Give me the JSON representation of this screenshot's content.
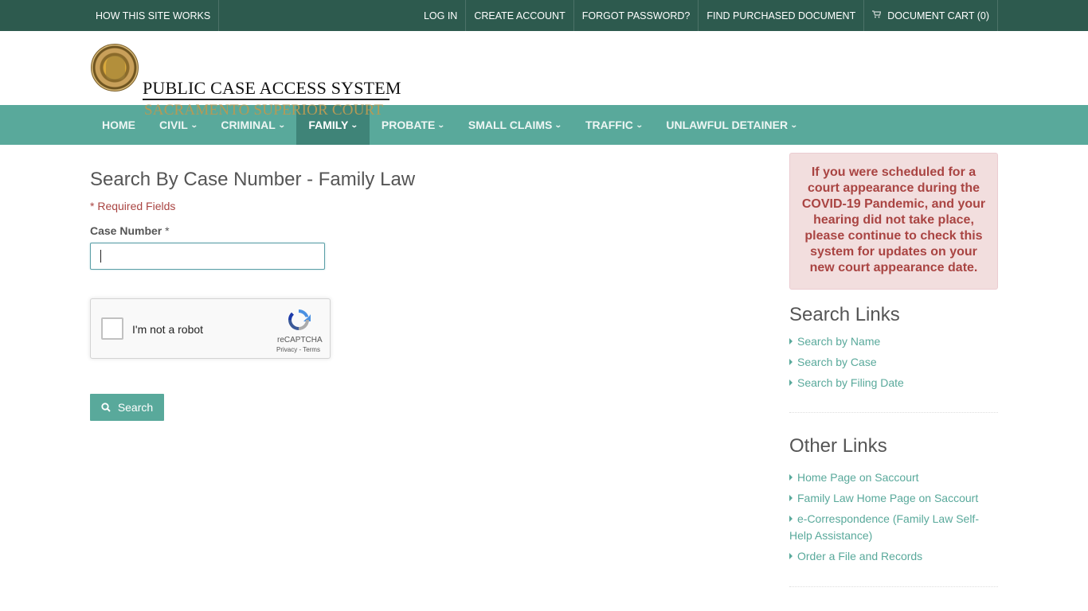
{
  "topbar": {
    "how_it_works": "HOW THIS SITE WORKS",
    "login": "LOG IN",
    "create_account": "CREATE ACCOUNT",
    "forgot_password": "FORGOT PASSWORD?",
    "find_purchased": "FIND PURCHASED DOCUMENT",
    "cart": "DOCUMENT CART (0)",
    "cart_icon": "shopping-cart-icon"
  },
  "header": {
    "title": "PUBLIC CASE ACCESS SYSTEM",
    "subtitle": "SACRAMENTO SUPERIOR COURT"
  },
  "nav": {
    "items": [
      {
        "label": "HOME",
        "dropdown": false
      },
      {
        "label": "CIVIL",
        "dropdown": true
      },
      {
        "label": "CRIMINAL",
        "dropdown": true
      },
      {
        "label": "FAMILY",
        "dropdown": true,
        "active": true
      },
      {
        "label": "PROBATE",
        "dropdown": true
      },
      {
        "label": "SMALL CLAIMS",
        "dropdown": true
      },
      {
        "label": "TRAFFIC",
        "dropdown": true
      },
      {
        "label": "UNLAWFUL DETAINER",
        "dropdown": true
      }
    ]
  },
  "main": {
    "title": "Search By Case Number - Family Law",
    "required_note": "* Required Fields",
    "case_number_label": "Case Number",
    "required_star": "*",
    "case_number_value": "",
    "recaptcha": {
      "label": "I'm not a robot",
      "brand": "reCAPTCHA",
      "terms": "Privacy - Terms"
    },
    "search_button": "Search"
  },
  "sidebar": {
    "alert": "If you were scheduled for a court appearance during the COVID-19 Pandemic, and your hearing did not take place, please continue to check this system for updates on your new court appearance date.",
    "search_links_heading": "Search Links",
    "search_links": [
      "Search by Name",
      "Search by Case",
      "Search by Filing Date"
    ],
    "other_links_heading": "Other Links",
    "other_links": [
      "Home Page on Saccourt",
      "Family Law Home Page on Saccourt",
      "e-Correspondence (Family Law Self-Help Assistance)",
      "Order a File and Records"
    ]
  },
  "colors": {
    "topbar": "#2d5a4e",
    "nav": "#59a99b",
    "nav_active": "#3f8478",
    "alert_bg": "#f2dede",
    "alert_text": "#a94442",
    "link": "#59a99b",
    "subtitle_gold": "#b49a56"
  }
}
